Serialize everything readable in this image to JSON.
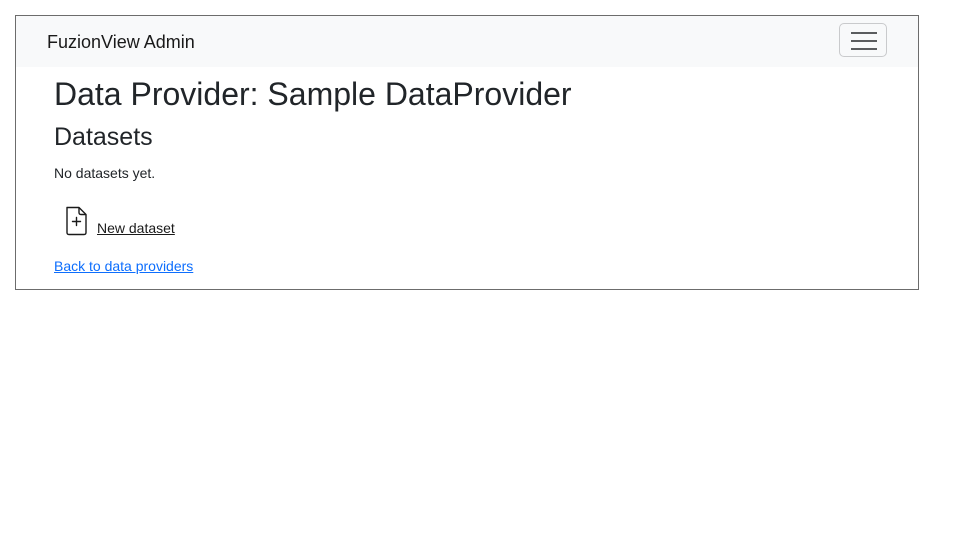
{
  "navbar": {
    "brand": "FuzionView Admin",
    "toggler_icon": "hamburger-menu-icon"
  },
  "main": {
    "title": "Data Provider: Sample DataProvider",
    "section_heading": "Datasets",
    "empty_message": "No datasets yet.",
    "new_dataset": {
      "icon": "file-plus-icon",
      "label": "New dataset"
    },
    "back_link": "Back to data providers"
  },
  "colors": {
    "navbar_bg": "#f8f9fa",
    "link": "#0d6efd",
    "text": "#212529",
    "border": "#6c6c6c"
  }
}
